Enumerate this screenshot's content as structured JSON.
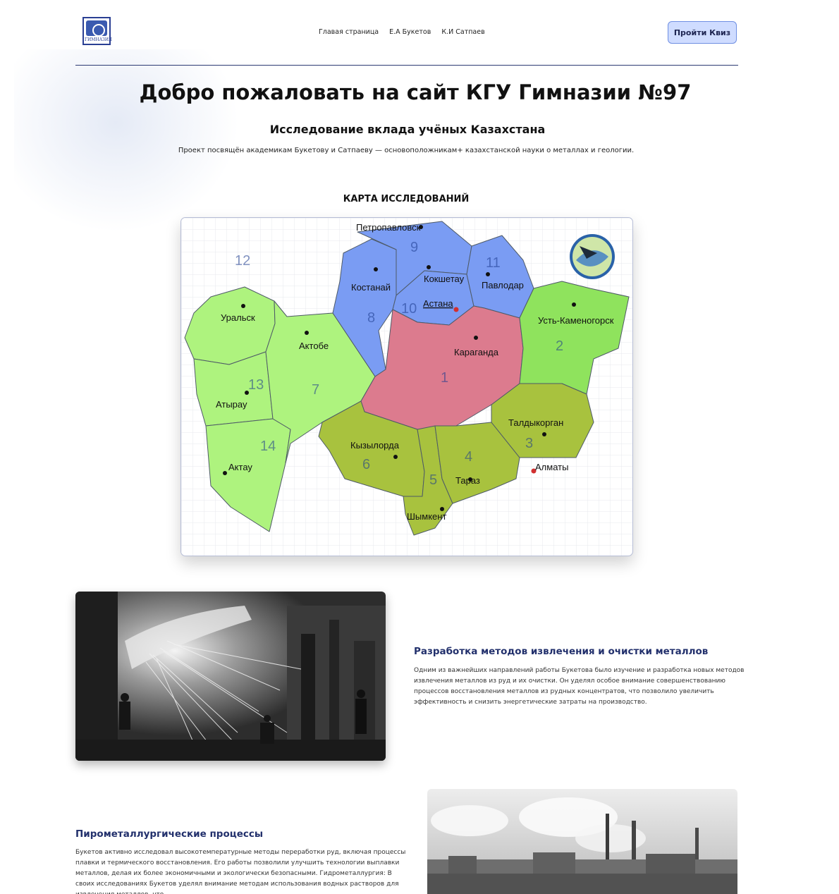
{
  "header": {
    "logo_text": "ГИМНАЗИЯ",
    "nav": [
      "Главая страница",
      "Е.А Букетов",
      "К.И Сатпаев"
    ],
    "quiz_button": "Пройти Квиз"
  },
  "hero": {
    "title": "Добро пожаловать на сайт КГУ Гимназии №97",
    "subtitle": "Исследование вклада учёных Казахстана",
    "description": "Проект посвящён академикам Букетову и Сатпаеву — основоположникам+ казахстанской науки о металлах и геологии."
  },
  "map": {
    "title": "КАРТА ИССЛЕДОВАНИЙ",
    "colors": {
      "blue": "#7a9cf3",
      "green_light": "#aef37e",
      "green_mid": "#8fe35d",
      "olive": "#a8c23e",
      "pink": "#dc7b8e"
    },
    "regions": [
      {
        "num": "1",
        "city": "Караганда"
      },
      {
        "num": "2",
        "city": "Усть-Каменогорск"
      },
      {
        "num": "3",
        "city": "Талдыкорган"
      },
      {
        "num": "4",
        "city": "Тараз"
      },
      {
        "num": "5",
        "city": "Шымкент"
      },
      {
        "num": "6",
        "city": "Кызылорда"
      },
      {
        "num": "7",
        "city": "Актобе"
      },
      {
        "num": "8",
        "city": "Костанай"
      },
      {
        "num": "9",
        "city": "Петропавловск"
      },
      {
        "num": "10",
        "city": "Астана"
      },
      {
        "num": "11",
        "city": "Павлодар"
      },
      {
        "num": "12",
        "city": "Уральск"
      },
      {
        "num": "13",
        "city": "Атырау"
      },
      {
        "num": "14",
        "city": "Актау"
      }
    ],
    "extra_cities": [
      "Кокшетау",
      "Алматы"
    ]
  },
  "sections": [
    {
      "title": "Разработка методов извлечения и очистки металлов",
      "text": "Одним из важнейших направлений работы Букетова было изучение и разработка новых методов извлечения металлов из руд и их очистки. Он уделял особое внимание совершенствованию процессов восстановления металлов из рудных концентратов, что позволило увеличить эффективность и снизить энергетические затраты на производство."
    },
    {
      "title": "Пирометаллургические процессы",
      "text": "Букетов активно исследовал высокотемпературные методы переработки руд, включая процессы плавки и термического восстановления. Его работы позволили улучшить технологии выплавки металлов, делая их более экономичными и экологически безопасными. Гидрометаллургия: В своих исследованиях Букетов уделял внимание методам использования водных растворов для извлечения металлов, что"
    }
  ]
}
